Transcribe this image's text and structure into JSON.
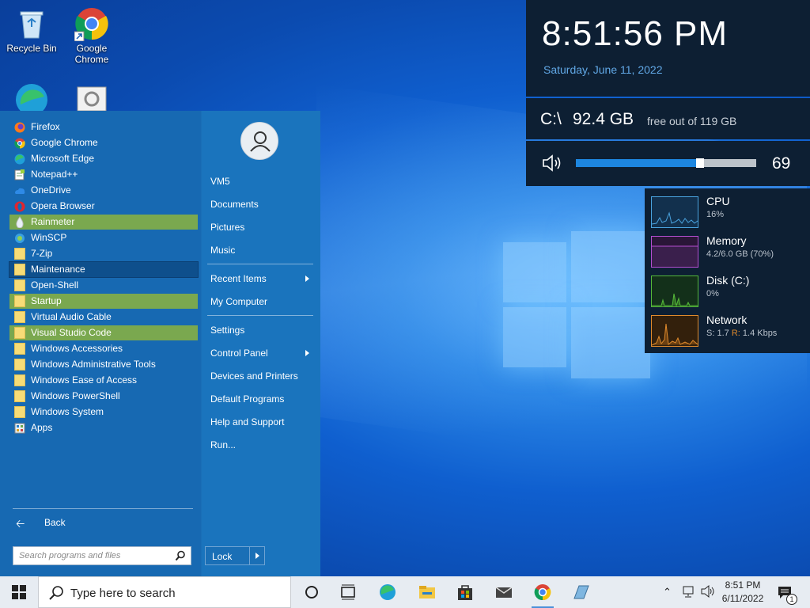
{
  "desktop": {
    "icons": [
      {
        "label": "Recycle Bin"
      },
      {
        "label": "Google Chrome"
      }
    ]
  },
  "start_menu": {
    "programs": [
      {
        "label": "Firefox",
        "icon": "firefox-icon"
      },
      {
        "label": "Google Chrome",
        "icon": "chrome-icon"
      },
      {
        "label": "Microsoft Edge",
        "icon": "edge-icon"
      },
      {
        "label": "Notepad++",
        "icon": "notepadpp-icon"
      },
      {
        "label": "OneDrive",
        "icon": "onedrive-icon"
      },
      {
        "label": "Opera Browser",
        "icon": "opera-icon"
      },
      {
        "label": "Rainmeter",
        "icon": "rainmeter-icon",
        "state": "highlighted"
      },
      {
        "label": "WinSCP",
        "icon": "winscp-icon"
      },
      {
        "label": "7-Zip",
        "icon": "folder-icon"
      },
      {
        "label": "Maintenance",
        "icon": "folder-icon",
        "state": "selected"
      },
      {
        "label": "Open-Shell",
        "icon": "folder-icon"
      },
      {
        "label": "Startup",
        "icon": "folder-icon",
        "state": "highlighted"
      },
      {
        "label": "Virtual Audio Cable",
        "icon": "folder-icon"
      },
      {
        "label": "Visual Studio Code",
        "icon": "folder-icon",
        "state": "highlighted"
      },
      {
        "label": "Windows Accessories",
        "icon": "folder-icon"
      },
      {
        "label": "Windows Administrative Tools",
        "icon": "folder-icon"
      },
      {
        "label": "Windows Ease of Access",
        "icon": "folder-icon"
      },
      {
        "label": "Windows PowerShell",
        "icon": "folder-icon"
      },
      {
        "label": "Windows System",
        "icon": "folder-icon"
      },
      {
        "label": "Apps",
        "icon": "apps-icon"
      }
    ],
    "back_label": "Back",
    "search_placeholder": "Search programs and files",
    "right_items": {
      "user": "VM5",
      "documents": "Documents",
      "pictures": "Pictures",
      "music": "Music",
      "recent_items": "Recent Items",
      "my_computer": "My Computer",
      "settings": "Settings",
      "control_panel": "Control Panel",
      "devices_printers": "Devices and Printers",
      "default_programs": "Default Programs",
      "help_support": "Help and Support",
      "run": "Run..."
    },
    "lock_label": "Lock"
  },
  "widgets": {
    "clock": {
      "time": "8:51:56 PM",
      "date": "Saturday, June 11, 2022"
    },
    "disk": {
      "drive": "C:\\",
      "free": "92.4 GB",
      "suffix": "free out of 119 GB"
    },
    "volume": {
      "level": 69,
      "level_text": "69"
    },
    "perf": {
      "cpu": {
        "title": "CPU",
        "value": "16%",
        "color": "#4aa3df"
      },
      "memory": {
        "title": "Memory",
        "value": "4.2/6.0 GB (70%)",
        "color": "#b44ed1"
      },
      "disk": {
        "title": "Disk (C:)",
        "value": "0%",
        "color": "#55b83a"
      },
      "network": {
        "title": "Network",
        "s_label": "S:",
        "s_value": "1.7",
        "r_label": "R:",
        "r_value": "1.4 Kbps",
        "color": "#e08a2c"
      }
    }
  },
  "taskbar": {
    "search_placeholder": "Type here to search",
    "time": "8:51 PM",
    "date": "6/11/2022",
    "notification_count": "1"
  }
}
